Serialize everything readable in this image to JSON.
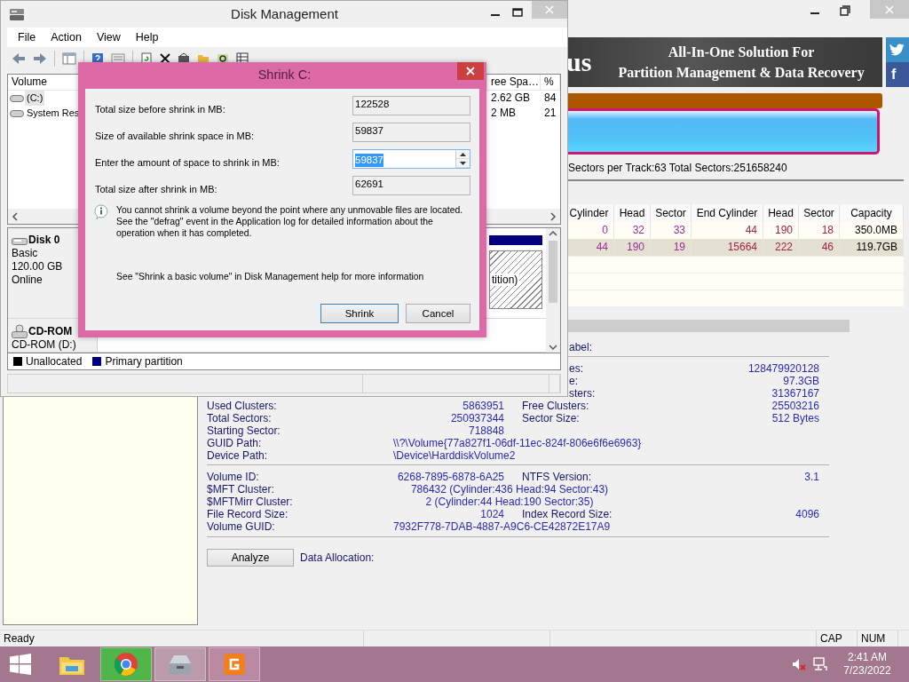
{
  "partition_tool": {
    "banner": {
      "brand_fragment": "us",
      "lines": [
        "All-In-One Solution For",
        "Partition Management & Data Recovery"
      ],
      "facebook": "f"
    },
    "disk_info": "Sectors per Track:63  Total Sectors:251658240",
    "partition_table": {
      "columns": [
        "Cylinder",
        "Head",
        "Sector",
        "End Cylinder",
        "Head",
        "Sector",
        "Capacity"
      ],
      "rows": [
        {
          "cells": [
            "0",
            "32",
            "33",
            "44",
            "190",
            "18",
            "350.0MB"
          ],
          "selected": false
        },
        {
          "cells": [
            "44",
            "190",
            "19",
            "15664",
            "222",
            "46",
            "119.7GB"
          ],
          "selected": true
        }
      ]
    },
    "details": [
      [
        {
          "kind": "partial",
          "label2": "abel:"
        }
      ],
      [
        {
          "kind": "partial",
          "label2": "es:",
          "value2": "128479920128"
        },
        {
          "kind": "partial",
          "label2": "e:",
          "value2": "97.3GB"
        },
        {
          "kind": "partial",
          "label2": "sters:",
          "value2": "31367167"
        },
        {
          "kind": "pair",
          "label": "Used Clusters:",
          "value": "5863951",
          "label2": "Free Clusters:",
          "value2": "25503216"
        },
        {
          "kind": "pair",
          "label": "Total Sectors:",
          "value": "250937344",
          "label2": "Sector Size:",
          "value2": "512 Bytes"
        },
        {
          "kind": "pair",
          "label": "Starting Sector:",
          "value": "718848"
        },
        {
          "kind": "wide",
          "label": "GUID Path:",
          "value": "\\\\?\\Volume{77a827f1-06df-11ec-824f-806e6f6e6963}"
        },
        {
          "kind": "wide",
          "label": "Device Path:",
          "value": "\\Device\\HarddiskVolume2"
        }
      ],
      [
        {
          "kind": "pair",
          "label": "Volume ID:",
          "value": "6268-7895-6878-6A25",
          "label2": "NTFS Version:",
          "value2": "3.1"
        },
        {
          "kind": "span",
          "label": "$MFT Cluster:",
          "value": "786432 (Cylinder:436 Head:94 Sector:43)"
        },
        {
          "kind": "span",
          "label": "$MFTMirr Cluster:",
          "value": "2 (Cylinder:44 Head:190 Sector:35)"
        },
        {
          "kind": "pair",
          "label": "File Record Size:",
          "value": "1024",
          "label2": "Index Record Size:",
          "value2": "4096"
        },
        {
          "kind": "wide",
          "label": "Volume GUID:",
          "value": "7932F778-7DAB-4887-A9C6-CE42872E17A9"
        }
      ]
    ],
    "analyze_button": "Analyze",
    "data_allocation": "Data Allocation:",
    "status_bar": {
      "message": "Ready",
      "indicators": [
        "CAP",
        "NUM"
      ]
    }
  },
  "disk_management": {
    "title": "Disk Management",
    "menu": [
      "File",
      "Action",
      "View",
      "Help"
    ],
    "volume_list": {
      "columns": [
        "Volume",
        "ree Spa…",
        "%"
      ],
      "rows": [
        {
          "name": "(C:)",
          "free": "2.62 GB",
          "percent": "84",
          "selected": true
        },
        {
          "name": "System Res",
          "free": "2 MB",
          "percent": "21",
          "selected": false
        }
      ]
    },
    "disks": [
      {
        "kind": "hdd",
        "name": "Disk 0",
        "lines": [
          "Basic",
          "120.00 GB",
          "Online"
        ],
        "partition_label": "tition)"
      },
      {
        "kind": "cdrom",
        "name": "CD-ROM",
        "lines": [
          "CD-ROM (D:)"
        ]
      }
    ],
    "legend": [
      {
        "label": "Unallocated",
        "color": "#000000"
      },
      {
        "label": "Primary partition",
        "color": "#00007f"
      }
    ]
  },
  "shrink_dialog": {
    "title": "Shrink C:",
    "fields": [
      {
        "kind": "readonly",
        "label": "Total size before shrink in MB:",
        "value": "122528"
      },
      {
        "kind": "readonly",
        "label": "Size of available shrink space in MB:",
        "value": "59837"
      },
      {
        "kind": "spin",
        "label": "Enter the amount of space to shrink in MB:",
        "value": "59837",
        "selected": true
      },
      {
        "kind": "readonly",
        "label": "Total size after shrink in MB:",
        "value": "62691"
      }
    ],
    "note": "You cannot shrink a volume beyond the point where any unmovable files are located. See the \"defrag\" event in the Application log for detailed information about the operation when it has completed.",
    "help": "See \"Shrink a basic volume\" in Disk Management help for more information",
    "buttons": [
      {
        "label": "Shrink",
        "default": true
      },
      {
        "label": "Cancel",
        "default": false
      }
    ]
  },
  "taskbar": {
    "apps": [
      {
        "kind": "explorer",
        "running": false
      },
      {
        "kind": "chrome",
        "running": true
      },
      {
        "kind": "disktool",
        "running": true
      },
      {
        "kind": "diskgenius",
        "running": true
      }
    ],
    "clock": {
      "time": "2:41 AM",
      "date": "7/23/2022"
    }
  }
}
